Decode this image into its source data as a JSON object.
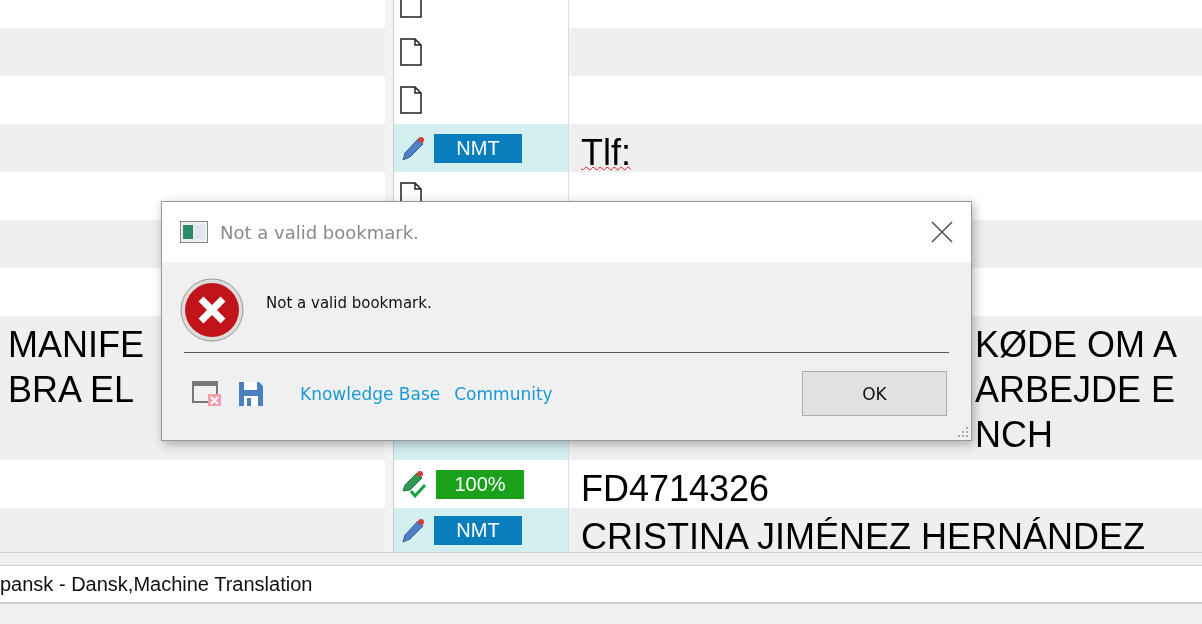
{
  "segments": [
    {
      "kind": "doc"
    },
    {
      "kind": "doc"
    },
    {
      "kind": "doc"
    },
    {
      "kind": "nmt",
      "badge": "NMT",
      "target_lines": [
        "Tlf:"
      ],
      "misspelled": true
    },
    {
      "kind": "doc"
    },
    {
      "kind": "covered"
    },
    {
      "kind": "covered"
    },
    {
      "source_lines": [
        "MANIFE",
        "BRA EL"
      ],
      "kind": "covered-edited",
      "target_lines": [
        "KØDE OM A",
        "ARBEJDE E",
        "NCH"
      ],
      "misspelled": false
    },
    {
      "kind": "exact",
      "badge": "100%",
      "target_lines": [
        "FD4714326"
      ],
      "misspelled": false
    },
    {
      "kind": "nmt",
      "badge": "NMT",
      "target_lines": [
        "CRISTINA JIMÉNEZ HERNÁNDEZ"
      ],
      "misspelled": false
    }
  ],
  "status_field": "pansk - Dansk,Machine Translation",
  "dialog": {
    "title": "Not a valid bookmark.",
    "message": "Not a valid bookmark.",
    "links": [
      "Knowledge Base",
      "Community"
    ],
    "button": "OK"
  }
}
